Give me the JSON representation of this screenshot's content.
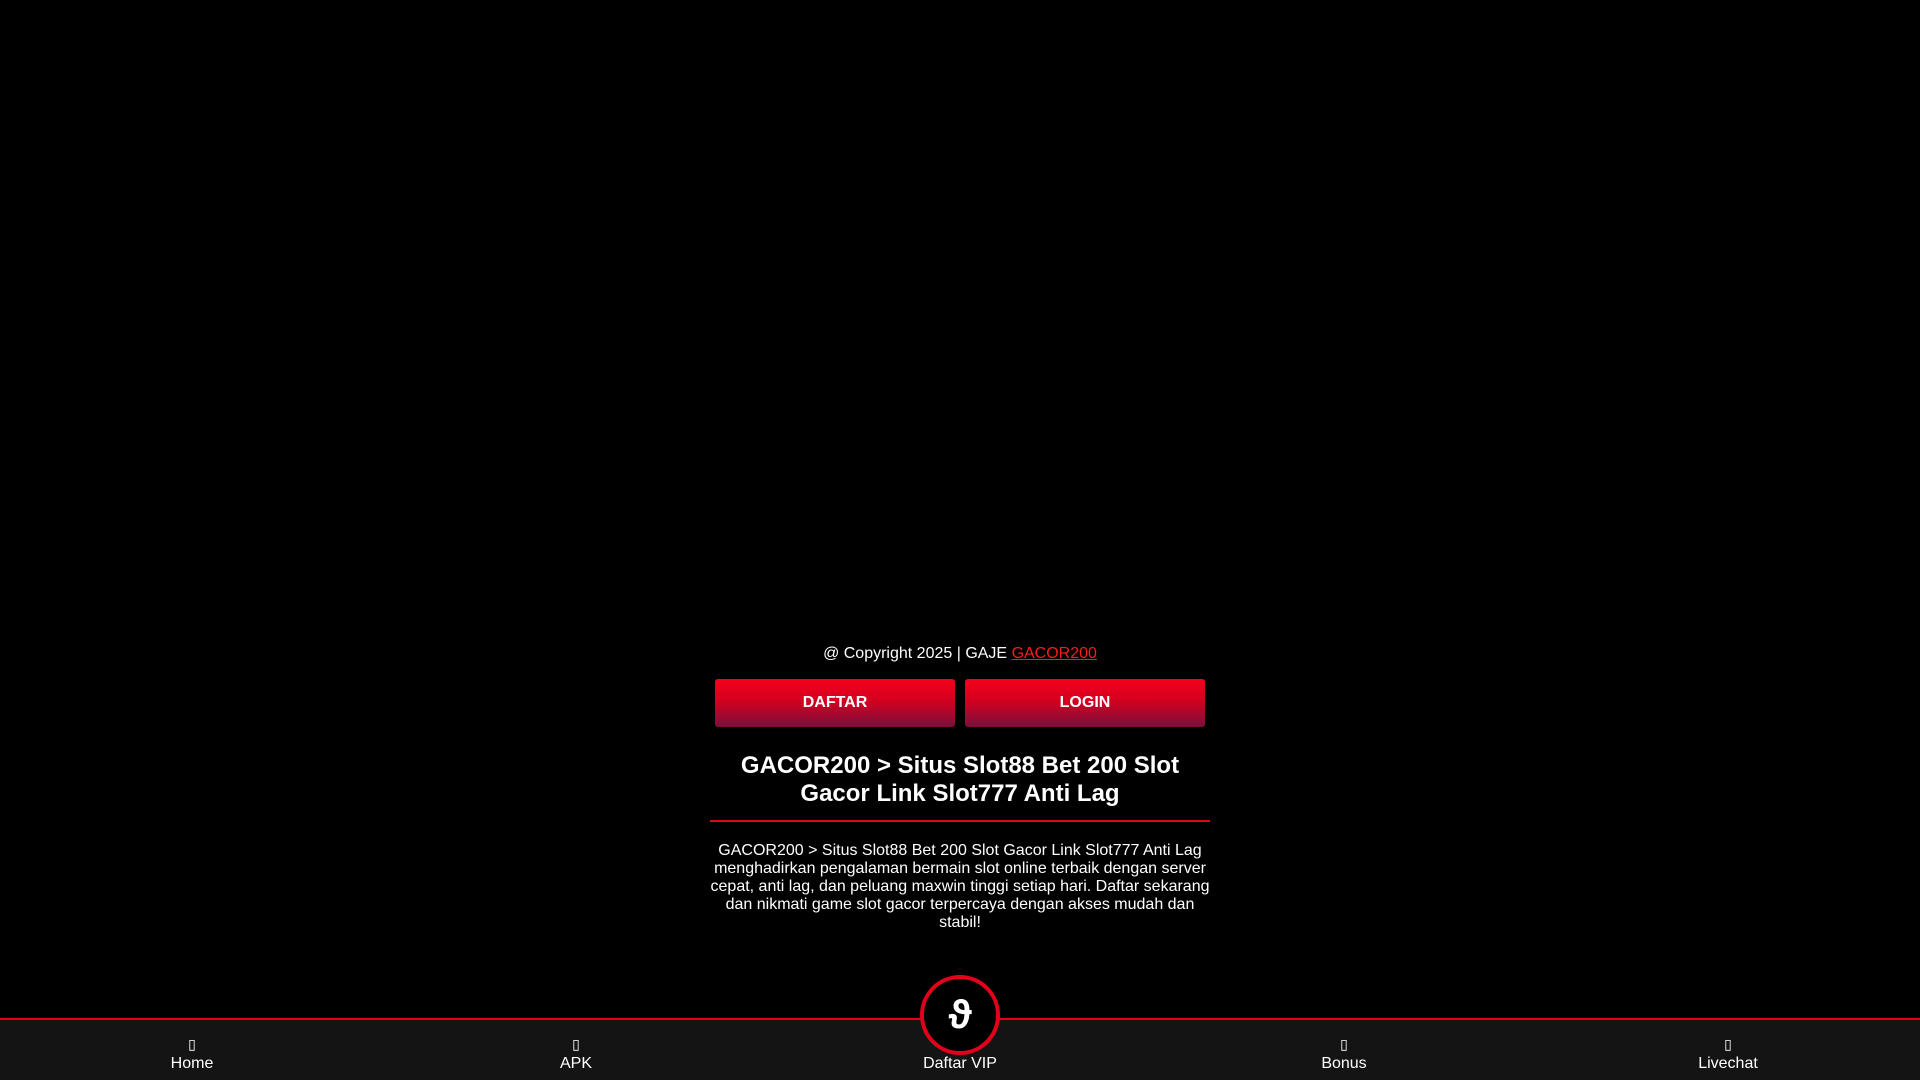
{
  "footer": {
    "copyright_text": "@ Copyright 2025 | GAJE",
    "brand_link": "GACOR200"
  },
  "buttons": {
    "daftar_label": "DAFTAR",
    "login_label": "LOGIN"
  },
  "article": {
    "title": "GACOR200 > Situs Slot88 Bet 200 Slot Gacor Link Slot777 Anti Lag",
    "description": "GACOR200 > Situs Slot88 Bet 200 Slot Gacor Link Slot777 Anti Lag menghadirkan pengalaman bermain slot online terbaik dengan server cepat, anti lag, dan peluang maxwin tinggi setiap hari. Daftar sekarang dan nikmati game slot gacor terpercaya dengan akses mudah dan stabil!"
  },
  "bottom_nav": {
    "items": [
      {
        "label": "Home",
        "icon": "home-icon",
        "glyph": "▯"
      },
      {
        "label": "APK",
        "icon": "apk-icon",
        "glyph": "▯"
      },
      {
        "label": "Daftar VIP",
        "icon": "vip-icon",
        "glyph": ""
      },
      {
        "label": "Bonus",
        "icon": "bonus-icon",
        "glyph": "▯"
      },
      {
        "label": "Livechat",
        "icon": "livechat-icon",
        "glyph": "▯"
      }
    ],
    "vip_glyph": "ϑ"
  },
  "colors": {
    "background": "#000000",
    "accent_red": "#e3001b",
    "link_red": "#ff1a1a",
    "nav_background": "#141414"
  }
}
